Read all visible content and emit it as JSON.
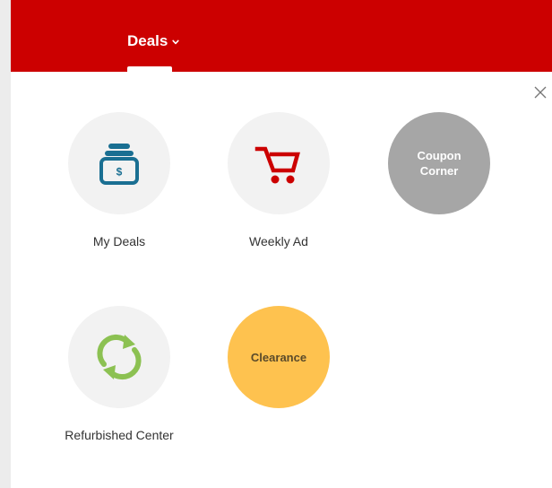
{
  "header": {
    "nav_label": "Deals",
    "brand_color": "#cc0000"
  },
  "close": {
    "icon": "close-icon",
    "symbol": "×"
  },
  "tiles": [
    {
      "label": "My Deals",
      "icon": "deals-stack-icon",
      "color": "#1a6f92"
    },
    {
      "label": "Weekly Ad",
      "icon": "cart-icon",
      "color": "#cc0000"
    },
    {
      "label": "",
      "circle_text": "Coupon Corner",
      "circle_color": "#a6a6a6"
    },
    {
      "label": "Refurbished Center",
      "icon": "refresh-icon",
      "color": "#8cc152"
    },
    {
      "label": "",
      "circle_text": "Clearance",
      "circle_color": "#fec24f"
    }
  ]
}
